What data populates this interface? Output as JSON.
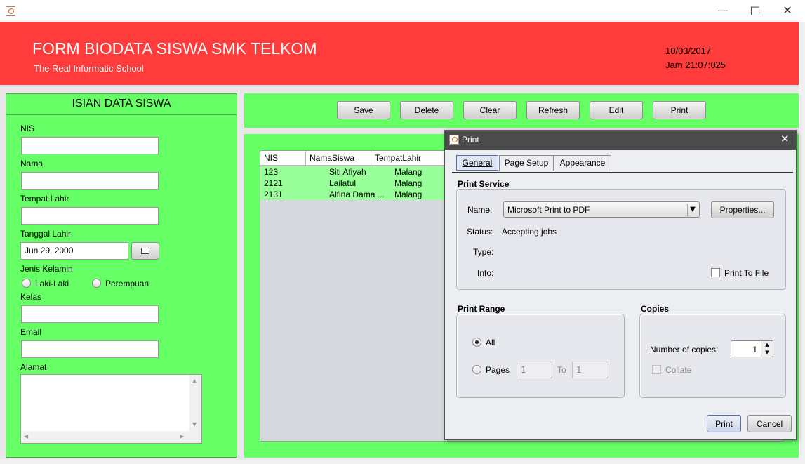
{
  "header": {
    "title": "FORM BIODATA SISWA SMK TELKOM",
    "subtitle": "The Real Informatic School",
    "date": "10/03/2017",
    "time": "Jam 21:07:025"
  },
  "form": {
    "heading": "ISIAN DATA SISWA",
    "nis_label": "NIS",
    "nama_label": "Nama",
    "tempat_lahir_label": "Tempat Lahir",
    "tanggal_lahir_label": "Tanggal Lahir",
    "tanggal_lahir_value": "Jun 29, 2000",
    "jenis_kelamin_label": "Jenis Kelamin",
    "gender_options": [
      "Laki-Laki",
      "Perempuan"
    ],
    "kelas_label": "Kelas",
    "email_label": "Email",
    "alamat_label": "Alamat"
  },
  "toolbar": {
    "buttons": [
      "Save",
      "Delete",
      "Clear",
      "Refresh",
      "Edit",
      "Print"
    ]
  },
  "table": {
    "columns": [
      "NIS",
      "NamaSiswa",
      "TempatLahir"
    ],
    "rows": [
      [
        "123",
        "Siti Afiyah",
        "Malang"
      ],
      [
        "2121",
        "Lailatul",
        "Malang"
      ],
      [
        "2131",
        "Alfina Dama ...",
        "Malang"
      ]
    ]
  },
  "dialog": {
    "title": "Print",
    "tabs": [
      "General",
      "Page Setup",
      "Appearance"
    ],
    "print_service_title": "Print Service",
    "name_label": "Name:",
    "printer_name": "Microsoft Print to PDF",
    "properties_button": "Properties...",
    "status_label": "Status:",
    "status_value": "Accepting jobs",
    "type_label": "Type:",
    "info_label": "Info:",
    "print_to_file_label": "Print To File",
    "print_range_title": "Print Range",
    "range_all_label": "All",
    "range_pages_label": "Pages",
    "pages_from": "1",
    "pages_to_label": "To",
    "pages_to": "1",
    "copies_title": "Copies",
    "copies_label": "Number of copies:",
    "copies_value": "1",
    "collate_label": "Collate",
    "print_button": "Print",
    "cancel_button": "Cancel"
  },
  "colors": {
    "header_red": "#ff3b3b",
    "panel_green": "#66ff66",
    "row_green": "#99ff99"
  }
}
